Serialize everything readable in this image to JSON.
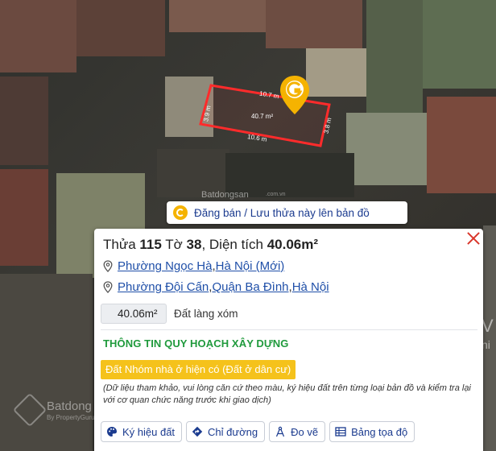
{
  "parcel": {
    "dimensions": {
      "top": "10.7 m",
      "bottom": "10.6 m",
      "left": "3.9 m",
      "right": "3.8 m",
      "area": "40.7 m²"
    },
    "outline_color": "#ff2b2b"
  },
  "watermarks": {
    "center_brand": "Batdongsan",
    "center_domain": ".com.vn",
    "bottom_brand": "Batdong",
    "bottom_sub": "By PropertyGuru",
    "side_letter": "V",
    "side_letter_2": "ni"
  },
  "save_banner": {
    "label": "Đăng bán / Lưu thửa này lên bản đồ"
  },
  "panel": {
    "title": {
      "parcel_prefix": "Thửa ",
      "parcel_number": "115",
      "sheet_prefix": " Tờ ",
      "sheet_number": "38",
      "area_prefix": ", Diện tích ",
      "area_value": "40.06m²"
    },
    "address_new": {
      "ward": "Phường Ngọc Hà",
      "separator": ", ",
      "city": "Hà Nội (Mới)"
    },
    "address_old": {
      "ward": "Phường Đội Cấn",
      "separator": ", ",
      "district": "Quận Ba Đình",
      "separator2": ", ",
      "city": "Hà Nội"
    },
    "area_badge": "40.06m²",
    "land_type": "Đất làng xóm",
    "planning_title": "THÔNG TIN QUY HOẠCH XÂY DỰNG",
    "planning_badge": "Đất Nhóm nhà ở hiện có (Đất ở dân cư)",
    "note": "(Dữ liệu tham khảo, vui lòng căn cứ theo màu, ký hiệu đất trên từng loại bản đồ và kiểm tra lại với cơ quan chức năng trước khi giao dịch)",
    "accent_green": "#1f9a3c",
    "accent_yellow": "#f5c21b",
    "link_blue": "#1f4fa8"
  },
  "buttons": [
    {
      "label": "Ký hiệu đất",
      "icon": "palette-icon"
    },
    {
      "label": "Chỉ đường",
      "icon": "directions-icon"
    },
    {
      "label": "Đo vẽ",
      "icon": "compass-icon"
    },
    {
      "label": "Bảng tọa độ",
      "icon": "table-icon"
    }
  ]
}
